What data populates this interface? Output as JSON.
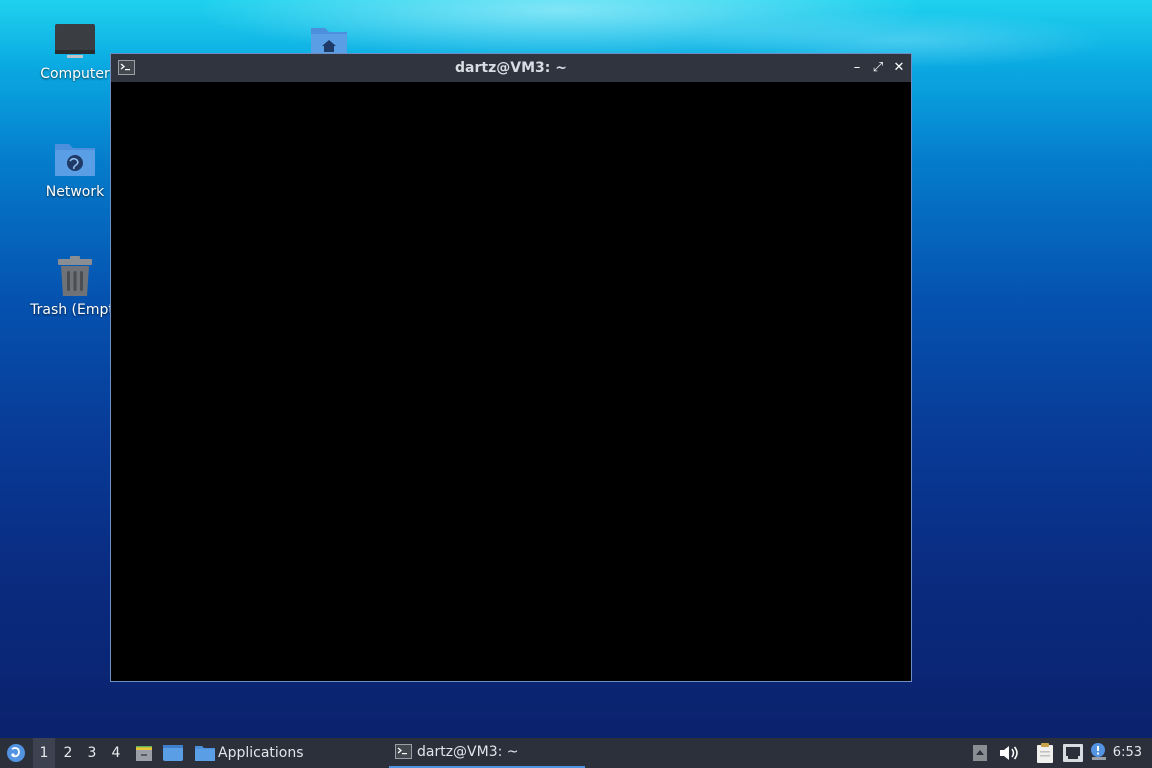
{
  "desktop": {
    "icons": [
      {
        "label": "Computer"
      },
      {
        "label": "Network"
      },
      {
        "label": "Trash (Empt"
      }
    ]
  },
  "terminal": {
    "title": "dartz@VM3: ~",
    "minimize_glyph": "–",
    "maximize_glyph": "⤢",
    "close_glyph": "✕"
  },
  "panel": {
    "workspaces": [
      "1",
      "2",
      "3",
      "4"
    ],
    "active_workspace": "1",
    "applications_label": "Applications",
    "task_label": "dartz@VM3: ~",
    "clock": "6:53"
  },
  "colors": {
    "accent": "#5294e2",
    "panel_bg": "#2b303b",
    "titlebar_bg": "#2f343f",
    "folder_blue": "#5a9ee6"
  }
}
